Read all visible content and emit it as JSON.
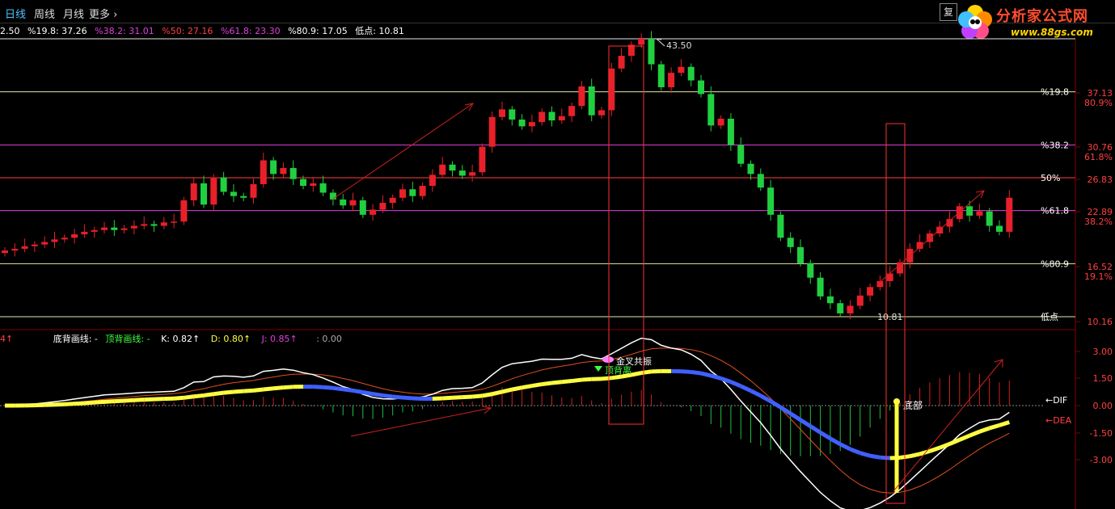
{
  "tabs": [
    {
      "label": "日线",
      "active": true
    },
    {
      "label": "周线",
      "active": false
    },
    {
      "label": "月线",
      "active": false
    },
    {
      "label": "更多 ›",
      "active": false
    }
  ],
  "corner_button": "复",
  "logo": {
    "title": "分析家公式网",
    "url": "www.88gs.com"
  },
  "fib_legend": [
    {
      "text": "2.50",
      "color": "#ffffff"
    },
    {
      "text": "%19.8: 37.26",
      "color": "#ffffff"
    },
    {
      "text": "%38.2: 31.01",
      "color": "#e040e0"
    },
    {
      "text": "%50: 27.16",
      "color": "#ff4040"
    },
    {
      "text": "%61.8: 23.30",
      "color": "#e040e0"
    },
    {
      "text": "%80.9: 17.05",
      "color": "#ffffff"
    },
    {
      "text": "低点: 10.81",
      "color": "#ffffff"
    }
  ],
  "fib_lines": [
    {
      "label": "%19.8",
      "color": "#e8e8a0",
      "price": 37.26
    },
    {
      "label": "%38.2",
      "color": "#e040e0",
      "price": 31.01
    },
    {
      "label": "50%",
      "color": "#ff4040",
      "price": 27.16
    },
    {
      "label": "%61.8",
      "color": "#e040e0",
      "price": 23.3
    },
    {
      "label": "%80.9",
      "color": "#e8e8a0",
      "price": 17.05
    },
    {
      "label": "低点",
      "color": "#e8e8a0",
      "price": 10.81
    }
  ],
  "top_line_price": 43.5,
  "price_axis": [
    {
      "price": "37.13",
      "pct": "80.9%"
    },
    {
      "price": "30.76",
      "pct": "61.8%"
    },
    {
      "price": "26.83",
      "pct": ""
    },
    {
      "price": "22.89",
      "pct": "38.2%"
    },
    {
      "price": "16.52",
      "pct": "19.1%"
    },
    {
      "price": "10.16",
      "pct": ""
    }
  ],
  "annotations": {
    "high": "43.50",
    "low": "10.81",
    "gold_resonance": "金叉共振",
    "top_divergence": "顶背离",
    "bottom": "底部",
    "dif": "←DIF",
    "dea": "←DEA"
  },
  "ind_legend": [
    {
      "text": "4↑",
      "color": "#ff4040"
    },
    {
      "text": "底背画线: -",
      "color": "#ffffff"
    },
    {
      "text": "顶背画线: -",
      "color": "#40ff40"
    },
    {
      "text": "K: 0.82↑",
      "color": "#ffffff"
    },
    {
      "text": "D: 0.80↑",
      "color": "#ffff40"
    },
    {
      "text": "J: 0.85↑",
      "color": "#e040e0"
    },
    {
      "text": ": 0.00",
      "color": "#aaaaaa"
    }
  ],
  "ind_axis": [
    "3.00",
    "1.50",
    "0.00",
    "-1.50",
    "-3.00"
  ],
  "chart_data": {
    "type": "candlestick",
    "close_series": [
      18.6,
      18.8,
      19.1,
      19.3,
      19.6,
      19.9,
      20.1,
      20.5,
      20.8,
      21.0,
      21.3,
      21.0,
      21.2,
      21.5,
      21.7,
      21.5,
      21.9,
      22.0,
      24.5,
      26.5,
      24.0,
      27.2,
      25.5,
      25.0,
      24.8,
      26.4,
      29.2,
      27.6,
      28.3,
      27.0,
      26.2,
      26.5,
      25.4,
      24.6,
      23.9,
      24.5,
      22.8,
      23.4,
      24.2,
      24.8,
      25.8,
      25.0,
      26.2,
      27.5,
      28.7,
      28.0,
      27.4,
      27.8,
      30.8,
      34.3,
      35.2,
      34.0,
      33.2,
      33.7,
      34.9,
      33.9,
      34.4,
      35.6,
      37.9,
      34.5,
      35.1,
      40.0,
      41.5,
      42.8,
      43.5,
      40.5,
      37.8,
      39.5,
      40.2,
      38.6,
      37.0,
      33.3,
      34.1,
      31.0,
      28.8,
      27.6,
      26.0,
      22.8,
      20.1,
      19.0,
      17.1,
      15.4,
      13.2,
      12.4,
      11.2,
      12.1,
      13.3,
      14.3,
      15.0,
      15.9,
      17.2,
      18.8,
      19.6,
      20.6,
      21.4,
      22.3,
      23.8,
      22.7,
      23.2,
      21.5,
      20.8,
      24.8
    ],
    "low_price": 10.81,
    "high_price": 43.5
  }
}
